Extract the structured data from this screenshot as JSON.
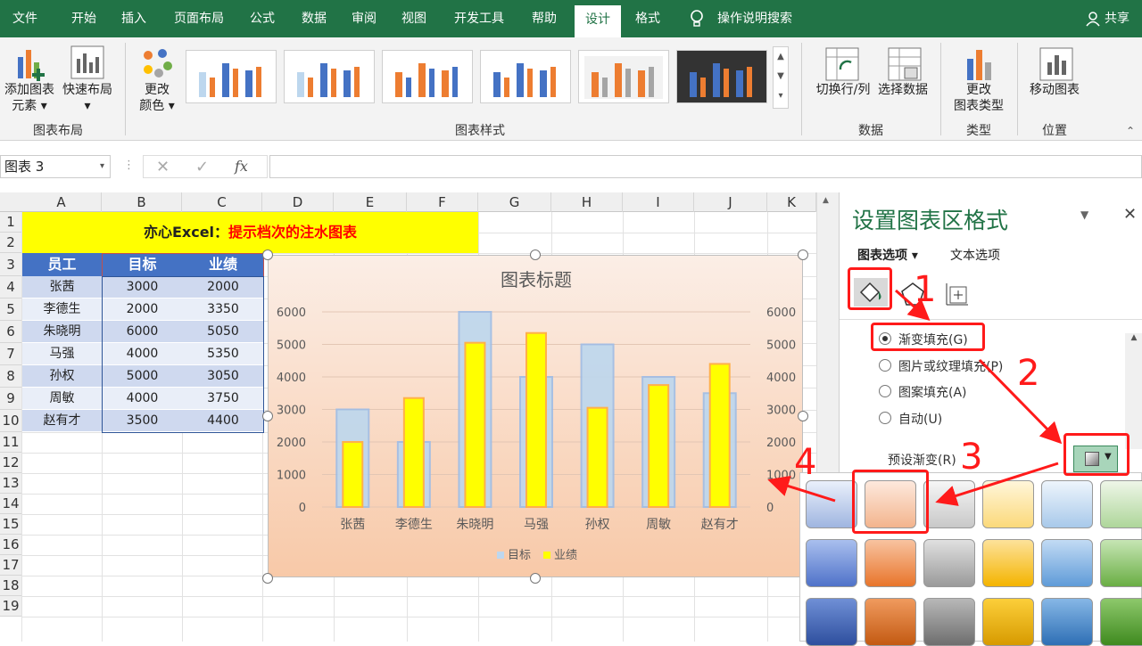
{
  "tabs": [
    "文件",
    "开始",
    "插入",
    "页面布局",
    "公式",
    "数据",
    "审阅",
    "视图",
    "开发工具",
    "帮助",
    "设计",
    "格式"
  ],
  "search_label": "操作说明搜索",
  "share_label": "共享",
  "ribbon": {
    "add_element": [
      "添加图表",
      "元素"
    ],
    "quick_layout": [
      "快速布局"
    ],
    "group_layout": "图表布局",
    "change_color": [
      "更改",
      "颜色"
    ],
    "group_styles": "图表样式",
    "switch_rowcol": "切换行/列",
    "select_data": "选择数据",
    "group_data": "数据",
    "change_type": [
      "更改",
      "图表类型"
    ],
    "group_type": "类型",
    "move_chart": "移动图表",
    "group_location": "位置"
  },
  "name_box": "图表 3",
  "fx_label": "fx",
  "columns": [
    "A",
    "B",
    "C",
    "D",
    "E",
    "F",
    "G",
    "H",
    "I",
    "J",
    "K"
  ],
  "rows": [
    "1",
    "2",
    "3",
    "4",
    "5",
    "6",
    "7",
    "8",
    "9",
    "10",
    "11",
    "12",
    "13",
    "14",
    "15",
    "16",
    "17",
    "18",
    "19"
  ],
  "title_cell": {
    "black": "亦心Excel：",
    "red": "提示档次的注水图表"
  },
  "table": {
    "headers": [
      "员工",
      "目标",
      "业绩"
    ],
    "rows": [
      [
        "张茜",
        "3000",
        "2000"
      ],
      [
        "李德生",
        "2000",
        "3350"
      ],
      [
        "朱晓明",
        "6000",
        "5050"
      ],
      [
        "马强",
        "4000",
        "5350"
      ],
      [
        "孙权",
        "5000",
        "3050"
      ],
      [
        "周敏",
        "4000",
        "3750"
      ],
      [
        "赵有才",
        "3500",
        "4400"
      ]
    ]
  },
  "chart_data": {
    "type": "bar",
    "title": "图表标题",
    "categories": [
      "张茜",
      "李德生",
      "朱晓明",
      "马强",
      "孙权",
      "周敏",
      "赵有才"
    ],
    "series": [
      {
        "name": "目标",
        "values": [
          3000,
          2000,
          6000,
          4000,
          5000,
          4000,
          3500
        ],
        "color": "#bdd7ee"
      },
      {
        "name": "业绩",
        "values": [
          2000,
          3350,
          5050,
          5350,
          3050,
          3750,
          4400
        ],
        "color": "#ffff00"
      }
    ],
    "ylim": [
      0,
      6000
    ],
    "yticks": [
      "0",
      "1000",
      "2000",
      "3000",
      "4000",
      "5000",
      "6000"
    ],
    "legend": "bottom",
    "grid": true
  },
  "pane": {
    "title": "设置图表区格式",
    "tab_chart": "图表选项",
    "tab_text": "文本选项",
    "options": [
      "渐变填充(G)",
      "图片或纹理填充(P)",
      "图案填充(A)",
      "自动(U)"
    ],
    "preset_label": "预设渐变(R)"
  },
  "annotations": [
    "1",
    "2",
    "3",
    "4"
  ]
}
